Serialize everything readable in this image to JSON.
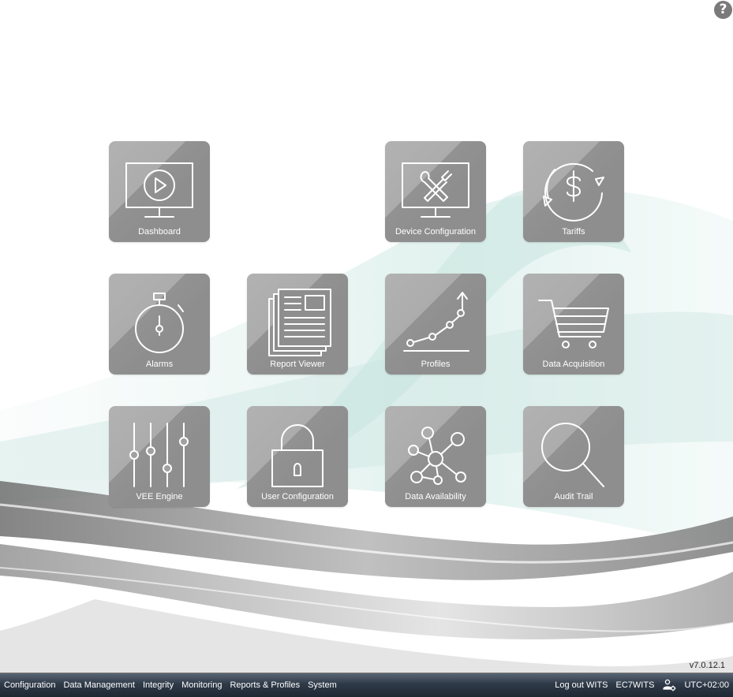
{
  "app": {
    "help_icon": "help-icon",
    "version": "v7.0.12.1"
  },
  "tiles": [
    {
      "label": "Dashboard",
      "icon": "monitor-play-icon"
    },
    {
      "label": "Device Configuration",
      "icon": "monitor-tools-icon"
    },
    {
      "label": "Tariffs",
      "icon": "dollar-cycle-icon"
    },
    {
      "label": "Alarms",
      "icon": "stopwatch-icon"
    },
    {
      "label": "Report Viewer",
      "icon": "newspaper-icon"
    },
    {
      "label": "Profiles",
      "icon": "line-graph-icon"
    },
    {
      "label": "Data Acquisition",
      "icon": "shopping-cart-icon"
    },
    {
      "label": "VEE Engine",
      "icon": "sliders-icon"
    },
    {
      "label": "User Configuration",
      "icon": "padlock-icon"
    },
    {
      "label": "Data Availability",
      "icon": "network-nodes-icon"
    },
    {
      "label": "Audit Trail",
      "icon": "magnifier-icon"
    }
  ],
  "taskbar": {
    "menu": [
      "Configuration",
      "Data Management",
      "Integrity",
      "Monitoring",
      "Reports & Profiles",
      "System"
    ],
    "logout": "Log out WITS",
    "user": "EC7WITS",
    "user_icon": "user-settings-icon",
    "timezone": "UTC+02:00"
  },
  "colors": {
    "tile_light": "#a9a9a9",
    "tile_dark": "#8e8e8e",
    "taskbar": "#2f3a48",
    "wave_teal": "#bfe0d9",
    "wave_gray": "#8a8a8a"
  }
}
